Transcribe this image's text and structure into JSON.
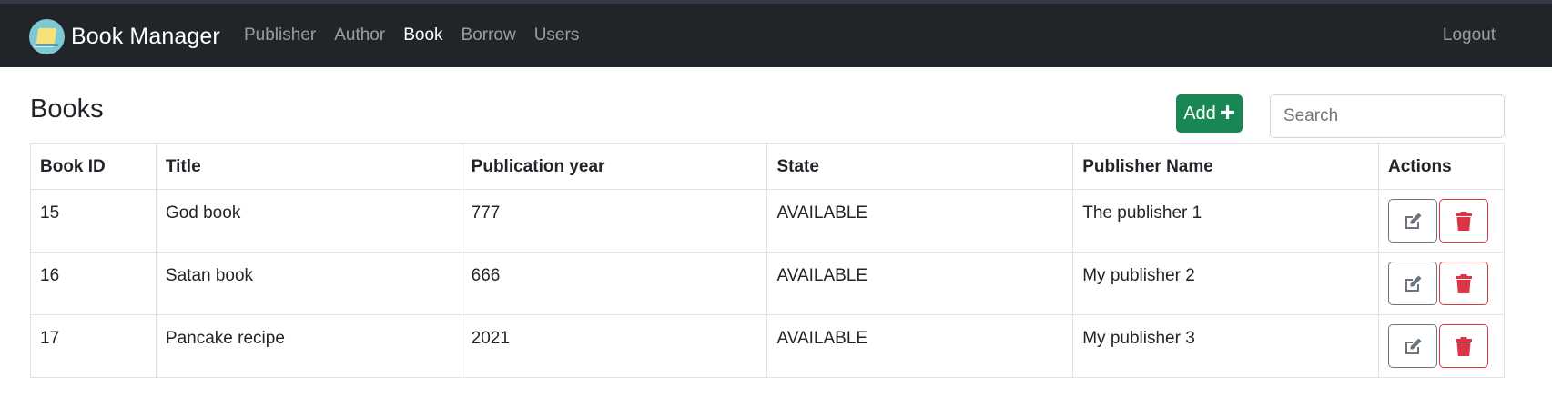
{
  "brand": {
    "name": "Book Manager",
    "logo_icon": "book-logo-icon"
  },
  "nav": {
    "items": [
      {
        "label": "Publisher",
        "active": false
      },
      {
        "label": "Author",
        "active": false
      },
      {
        "label": "Book",
        "active": true
      },
      {
        "label": "Borrow",
        "active": false
      },
      {
        "label": "Users",
        "active": false
      }
    ],
    "logout": "Logout"
  },
  "page": {
    "title": "Books"
  },
  "toolbar": {
    "add_label": "Add",
    "add_icon": "plus-icon",
    "search_placeholder": "Search",
    "search_value": ""
  },
  "table": {
    "headers": [
      "Book ID",
      "Title",
      "Publication year",
      "State",
      "Publisher Name",
      "Actions"
    ],
    "rows": [
      {
        "id": "15",
        "title": "God book",
        "year": "777",
        "state": "AVAILABLE",
        "publisher": "The publisher 1"
      },
      {
        "id": "16",
        "title": "Satan book",
        "year": "666",
        "state": "AVAILABLE",
        "publisher": "My publisher 2"
      },
      {
        "id": "17",
        "title": "Pancake recipe",
        "year": "2021",
        "state": "AVAILABLE",
        "publisher": "My publisher 3"
      }
    ],
    "row_actions": {
      "edit_icon": "edit-icon",
      "delete_icon": "trash-icon"
    }
  },
  "colors": {
    "navbar": "#212529",
    "add_button": "#198754",
    "delete": "#dc3545",
    "edit": "#6c757d"
  }
}
